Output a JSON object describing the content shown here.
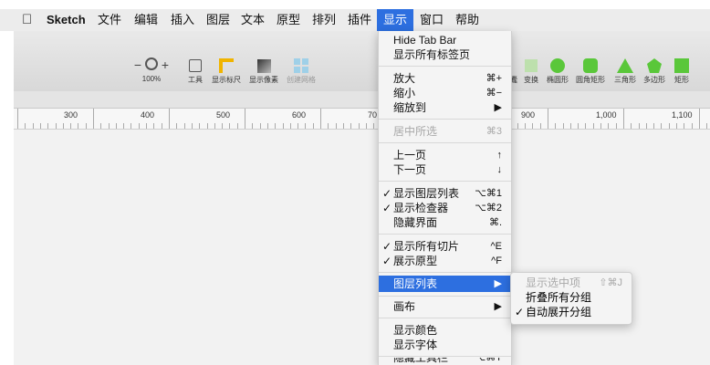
{
  "menubar": {
    "items": [
      "Sketch",
      "文件",
      "编辑",
      "插入",
      "图层",
      "文本",
      "原型",
      "排列",
      "插件",
      "显示",
      "窗口",
      "帮助"
    ]
  },
  "toolbar": {
    "zoom_minus": "−",
    "zoom_plus": "+",
    "zoom_level": "100%",
    "tools_label": "工具",
    "show_rulers_label": "显示标尺",
    "show_pixels_label": "显示像素",
    "create_grid_label": "创建网格",
    "shapes": [
      {
        "label": "变换"
      },
      {
        "label": "椭圆形"
      },
      {
        "label": "圆角矩形"
      },
      {
        "label": "三角形"
      },
      {
        "label": "多边形"
      },
      {
        "label": "矩形"
      }
    ],
    "partial_label": "蠹"
  },
  "ruler": {
    "labels": [
      "300",
      "400",
      "500",
      "600",
      "70",
      "900",
      "1,000",
      "1,100"
    ]
  },
  "view_menu": {
    "items": [
      {
        "label": "Hide Tab Bar",
        "shortcut": "",
        "check": ""
      },
      {
        "label": "显示所有标签页",
        "shortcut": "",
        "check": ""
      },
      {
        "label": "放大",
        "shortcut": "⌘+",
        "check": ""
      },
      {
        "label": "缩小",
        "shortcut": "⌘−",
        "check": ""
      },
      {
        "label": "缩放到",
        "shortcut": "▶",
        "check": ""
      },
      {
        "label": "居中所选",
        "shortcut": "⌘3",
        "check": ""
      },
      {
        "label": "上一页",
        "shortcut": "↑",
        "check": ""
      },
      {
        "label": "下一页",
        "shortcut": "↓",
        "check": ""
      },
      {
        "label": "显示图层列表",
        "shortcut": "⌥⌘1",
        "check": "✓"
      },
      {
        "label": "显示检查器",
        "shortcut": "⌥⌘2",
        "check": "✓"
      },
      {
        "label": "隐藏界面",
        "shortcut": "⌘.",
        "check": ""
      },
      {
        "label": "显示所有切片",
        "shortcut": "^E",
        "check": "✓"
      },
      {
        "label": "展示原型",
        "shortcut": "^F",
        "check": "✓"
      },
      {
        "label": "图层列表",
        "shortcut": "▶",
        "check": ""
      },
      {
        "label": "画布",
        "shortcut": "▶",
        "check": ""
      },
      {
        "label": "显示颜色",
        "shortcut": "",
        "check": ""
      },
      {
        "label": "显示字体",
        "shortcut": "",
        "check": ""
      },
      {
        "label": "隐藏工具栏",
        "shortcut": "⌥⌘T",
        "check": ""
      }
    ]
  },
  "layer_submenu": {
    "items": [
      {
        "label": "显示选中项",
        "shortcut": "⇧⌘J",
        "check": ""
      },
      {
        "label": "折叠所有分组",
        "shortcut": "",
        "check": ""
      },
      {
        "label": "自动展开分组",
        "shortcut": "",
        "check": "✓"
      }
    ]
  },
  "colors": {
    "highlight": "#2d6fe0",
    "shape_green": "#5ac73a",
    "ruler_yellow": "#f0b400"
  }
}
